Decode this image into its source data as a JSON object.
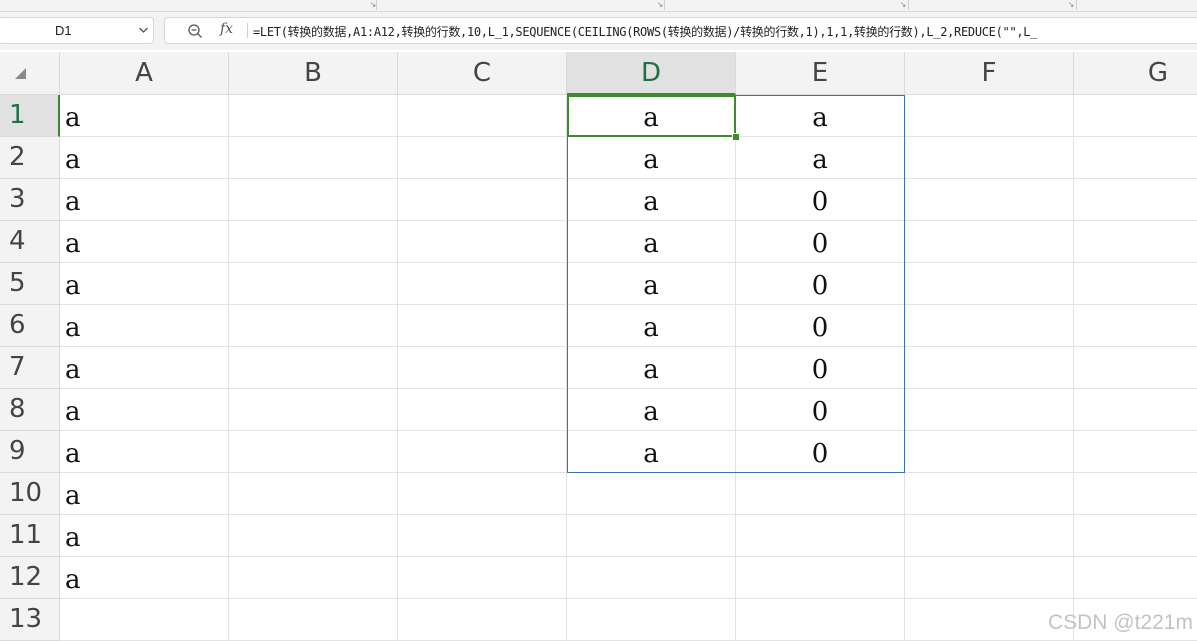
{
  "formula_bar": {
    "name_box": "D1",
    "fx_label": "fx",
    "formula": "=LET(转换的数据,A1:A12,转换的行数,10,L_1,SEQUENCE(CEILING(ROWS(转换的数据)/转换的行数,1),1,1,转换的行数),L_2,REDUCE(\"\",L_"
  },
  "sheet": {
    "columns": [
      "A",
      "B",
      "C",
      "D",
      "E",
      "F",
      "G"
    ],
    "active_column": "D",
    "rows": [
      "1",
      "2",
      "3",
      "4",
      "5",
      "6",
      "7",
      "8",
      "9",
      "10",
      "11",
      "12",
      "13"
    ],
    "active_row": "1",
    "active_cell": "D1",
    "spill_range": "D1:E9",
    "cells": {
      "A": [
        "a",
        "a",
        "a",
        "a",
        "a",
        "a",
        "a",
        "a",
        "a",
        "a",
        "a",
        "a",
        ""
      ],
      "D": [
        "a",
        "a",
        "a",
        "a",
        "a",
        "a",
        "a",
        "a",
        "a",
        "",
        "",
        "",
        ""
      ],
      "E": [
        "a",
        "a",
        "0",
        "0",
        "0",
        "0",
        "0",
        "0",
        "0",
        "",
        "",
        "",
        ""
      ]
    }
  },
  "colors": {
    "active_green": "#3f8a2d",
    "spill_blue": "#3b6fb6",
    "header_bg": "#f3f3f3"
  },
  "watermark": "CSDN @t221m"
}
